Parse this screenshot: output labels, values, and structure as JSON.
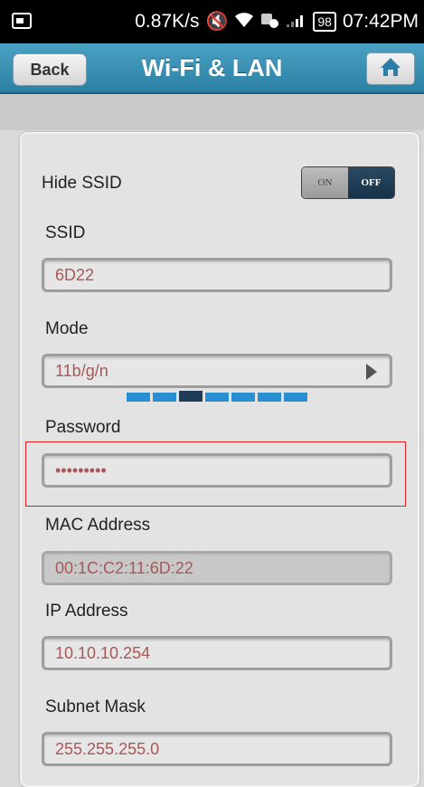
{
  "status_bar": {
    "speed": "0.87K/s",
    "battery": "98",
    "time": "07:42PM"
  },
  "header": {
    "back_label": "Back",
    "title": "Wi-Fi & LAN"
  },
  "form": {
    "hide_ssid": {
      "label": "Hide SSID",
      "on": "ON",
      "off": "OFF",
      "state": "OFF"
    },
    "ssid": {
      "label": "SSID",
      "value": "6D22"
    },
    "mode": {
      "label": "Mode",
      "value": "11b/g/n",
      "page_count": 7,
      "active_page": 3
    },
    "password": {
      "label": "Password",
      "value": "•••••••••"
    },
    "mac": {
      "label": "MAC Address",
      "value": "00:1C:C2:11:6D:22"
    },
    "ip": {
      "label": "IP Address",
      "value": "10.10.10.254"
    },
    "subnet": {
      "label": "Subnet Mask",
      "value": "255.255.255.0"
    }
  },
  "colors": {
    "header": "#2b7fa3",
    "value_text": "#a85858",
    "highlight": "#e02020"
  }
}
